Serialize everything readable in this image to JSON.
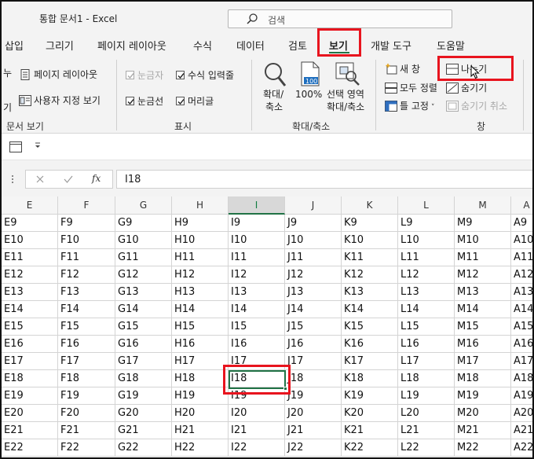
{
  "window": {
    "title": "통합 문서1  -  Excel"
  },
  "search": {
    "placeholder": "검색"
  },
  "tabs": [
    {
      "label": "삽입"
    },
    {
      "label": "그리기"
    },
    {
      "label": "페이지 레이아웃"
    },
    {
      "label": "수식"
    },
    {
      "label": "데이터"
    },
    {
      "label": "검토"
    },
    {
      "label": "보기"
    },
    {
      "label": "개발 도구"
    },
    {
      "label": "도움말"
    }
  ],
  "active_tab": "보기",
  "ribbon": {
    "workbook_views": {
      "page_layout": "페이지 레이아웃",
      "custom_views": "사용자 지정 보기",
      "partial_left": "누",
      "partial_left2": "기",
      "group_label": "문서 보기"
    },
    "show": {
      "ruler": {
        "label": "눈금자",
        "checked": true,
        "disabled": true
      },
      "formula_bar": {
        "label": "수식 입력줄",
        "checked": true
      },
      "gridlines": {
        "label": "눈금선",
        "checked": true
      },
      "headings": {
        "label": "머리글",
        "checked": true
      },
      "group_label": "표시"
    },
    "zoom": {
      "zoom_label_1": "확대/",
      "zoom_label_2": "축소",
      "hundred_label": "100%",
      "hundred_icon_text": "100",
      "selection_label_1": "선택 영역",
      "selection_label_2": "확대/축소",
      "group_label": "확대/축소"
    },
    "window": {
      "new_window": "새 창",
      "arrange_all": "모두 정렬",
      "freeze_panes": "틀 고정",
      "split": "나누기",
      "hide": "숨기기",
      "unhide": "숨기기 취소",
      "group_label": "창"
    }
  },
  "formula_bar": {
    "value": "I18"
  },
  "columns": [
    "E",
    "F",
    "G",
    "H",
    "I",
    "J",
    "K",
    "L",
    "M",
    "A"
  ],
  "selected_column": "I",
  "rows": [
    [
      "E9",
      "F9",
      "G9",
      "H9",
      "I9",
      "J9",
      "K9",
      "L9",
      "M9",
      "A9"
    ],
    [
      "E10",
      "F10",
      "G10",
      "H10",
      "I10",
      "J10",
      "K10",
      "L10",
      "M10",
      "A10"
    ],
    [
      "E11",
      "F11",
      "G11",
      "H11",
      "I11",
      "J11",
      "K11",
      "L11",
      "M11",
      "A11"
    ],
    [
      "E12",
      "F12",
      "G12",
      "H12",
      "I12",
      "J12",
      "K12",
      "L12",
      "M12",
      "A12"
    ],
    [
      "E13",
      "F13",
      "G13",
      "H13",
      "I13",
      "J13",
      "K13",
      "L13",
      "M13",
      "A13"
    ],
    [
      "E14",
      "F14",
      "G14",
      "H14",
      "I14",
      "J14",
      "K14",
      "L14",
      "M14",
      "A14"
    ],
    [
      "E15",
      "F15",
      "G15",
      "H15",
      "I15",
      "J15",
      "K15",
      "L15",
      "M15",
      "A15"
    ],
    [
      "E16",
      "F16",
      "G16",
      "H16",
      "I16",
      "J16",
      "K16",
      "L16",
      "M16",
      "A16"
    ],
    [
      "E17",
      "F17",
      "G17",
      "H17",
      "I17",
      "J17",
      "K17",
      "L17",
      "M17",
      "A17"
    ],
    [
      "E18",
      "F18",
      "G18",
      "H18",
      "I18",
      "J18",
      "K18",
      "L18",
      "M18",
      "A18"
    ],
    [
      "E19",
      "F19",
      "G19",
      "H19",
      "I19",
      "J19",
      "K19",
      "L19",
      "M19",
      "A19"
    ],
    [
      "E20",
      "F20",
      "G20",
      "H20",
      "I20",
      "J20",
      "K20",
      "L20",
      "M20",
      "A20"
    ],
    [
      "E21",
      "F21",
      "G21",
      "H21",
      "I21",
      "J21",
      "K21",
      "L21",
      "M21",
      "A21"
    ],
    [
      "E22",
      "F22",
      "G22",
      "H22",
      "I22",
      "J22",
      "K22",
      "L22",
      "M22",
      "A22"
    ]
  ],
  "active_cell": "I18",
  "colors": {
    "accent": "#217346",
    "highlight": "#e8141e"
  }
}
